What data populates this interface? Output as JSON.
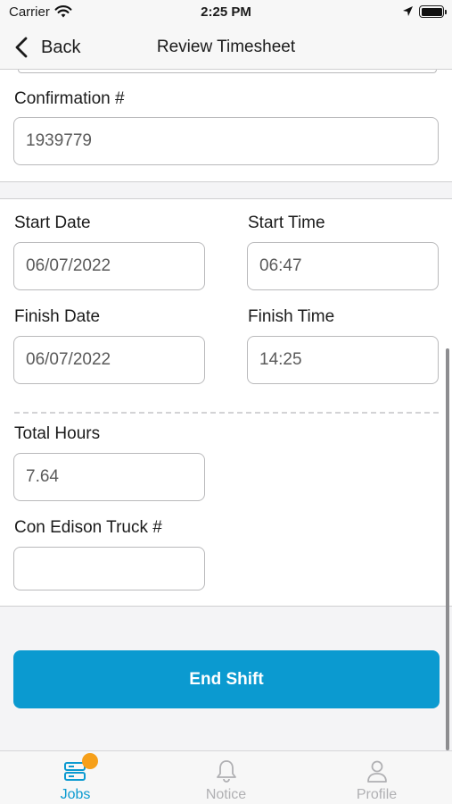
{
  "status_bar": {
    "carrier": "Carrier",
    "time": "2:25 PM"
  },
  "nav": {
    "back_label": "Back",
    "title": "Review Timesheet"
  },
  "confirmation": {
    "label": "Confirmation #",
    "value": "1939779"
  },
  "start_date": {
    "label": "Start Date",
    "value": "06/07/2022"
  },
  "start_time": {
    "label": "Start Time",
    "value": "06:47"
  },
  "finish_date": {
    "label": "Finish Date",
    "value": "06/07/2022"
  },
  "finish_time": {
    "label": "Finish Time",
    "value": "14:25"
  },
  "total_hours": {
    "label": "Total Hours",
    "value": "7.64"
  },
  "truck": {
    "label": "Con Edison Truck #",
    "value": ""
  },
  "end_shift_label": "End Shift",
  "tabs": [
    {
      "label": "Jobs",
      "icon": "jobs-icon",
      "active": true,
      "badge": true
    },
    {
      "label": "Notice",
      "icon": "bell-icon",
      "active": false
    },
    {
      "label": "Profile",
      "icon": "person-icon",
      "active": false
    }
  ],
  "colors": {
    "accent": "#0b9ad0",
    "badge": "#f6a01a",
    "inactive_tab": "#b0b0b3"
  }
}
